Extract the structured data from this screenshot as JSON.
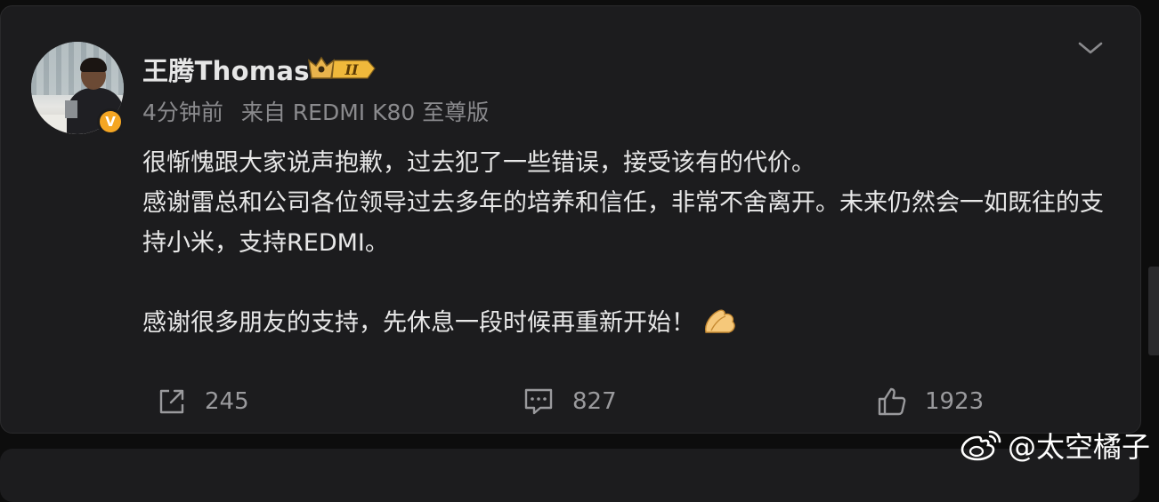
{
  "post": {
    "author": "王腾Thomas",
    "rank_badge_label": "II",
    "verified_badge": "V",
    "meta": {
      "time": "4分钟前",
      "source": "来自 REDMI K80 至尊版"
    },
    "content": {
      "line1": "很惭愧跟大家说声抱歉，过去犯了一些错误，接受该有的代价。",
      "line2": "感谢雷总和公司各位领导过去多年的培养和信任，非常不舍离开。未来仍然会一如既往的支持小米，支持REDMI。",
      "line3": "感谢很多朋友的支持，先休息一段时候再重新开始！",
      "emoji": "pinched-hand-emoji"
    },
    "actions": {
      "share_count": "245",
      "comment_count": "827",
      "like_count": "1923"
    }
  },
  "watermark": {
    "text": "@太空橘子"
  },
  "colors": {
    "page_bg": "#0d0d0d",
    "card_bg": "#1c1c1e",
    "text_primary": "#e8e8e8",
    "text_secondary": "#8a8a8d",
    "badge_orange": "#f5a623"
  }
}
